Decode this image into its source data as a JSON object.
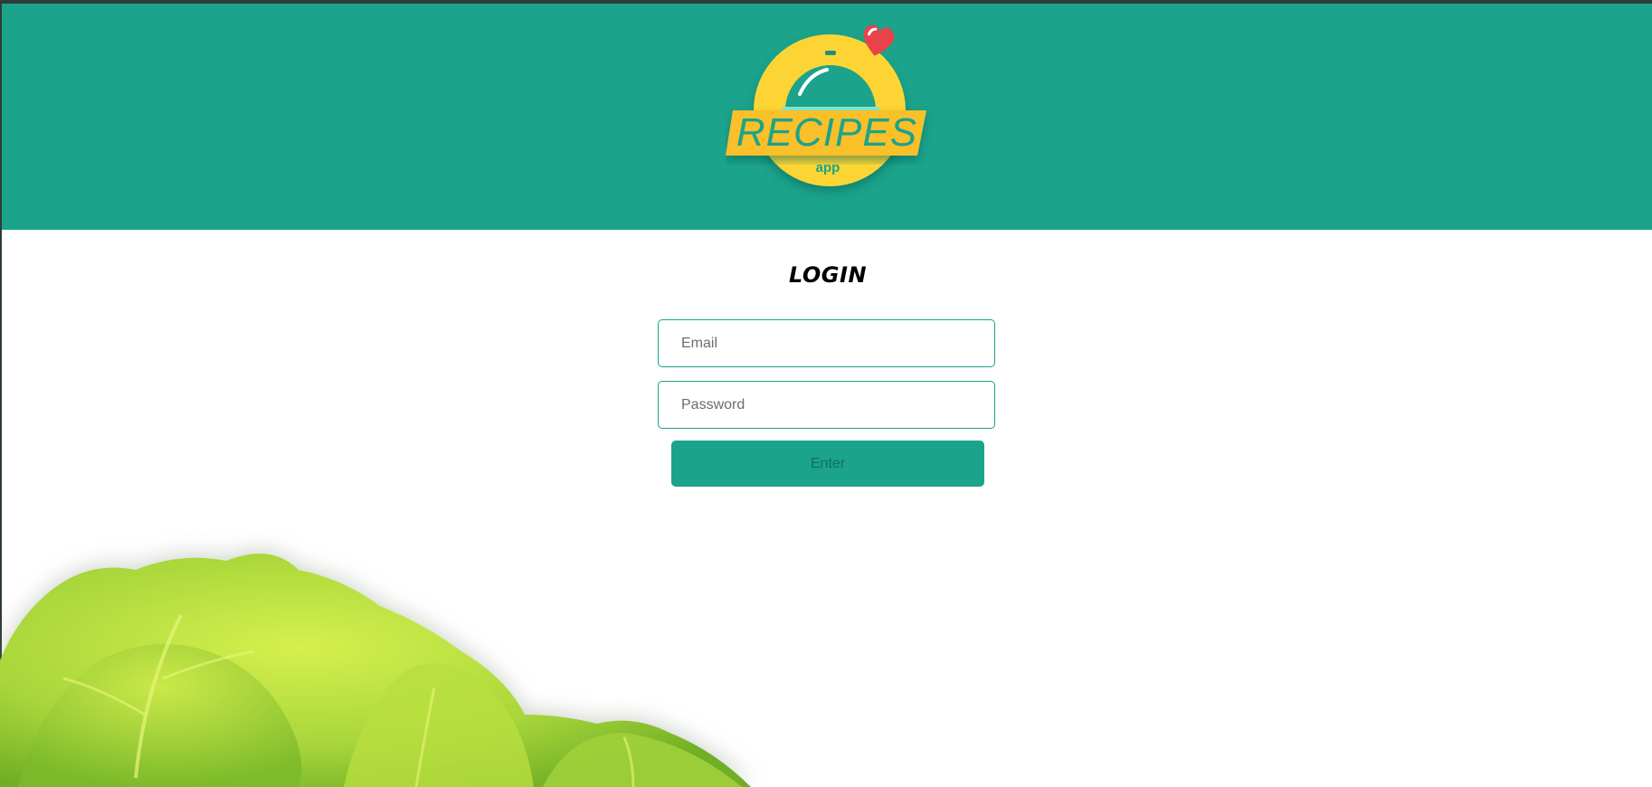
{
  "header": {
    "logo_text": "RECIPES",
    "logo_subtext": "app"
  },
  "login": {
    "title": "LOGIN",
    "email_placeholder": "Email",
    "password_placeholder": "Password",
    "enter_label": "Enter"
  },
  "colors": {
    "brand_teal": "#1ba38b",
    "logo_yellow": "#fcd534",
    "heart_red": "#e8424a",
    "lettuce_green": "#a6d63a"
  },
  "icons": [
    "heart-icon",
    "cloche-icon"
  ]
}
